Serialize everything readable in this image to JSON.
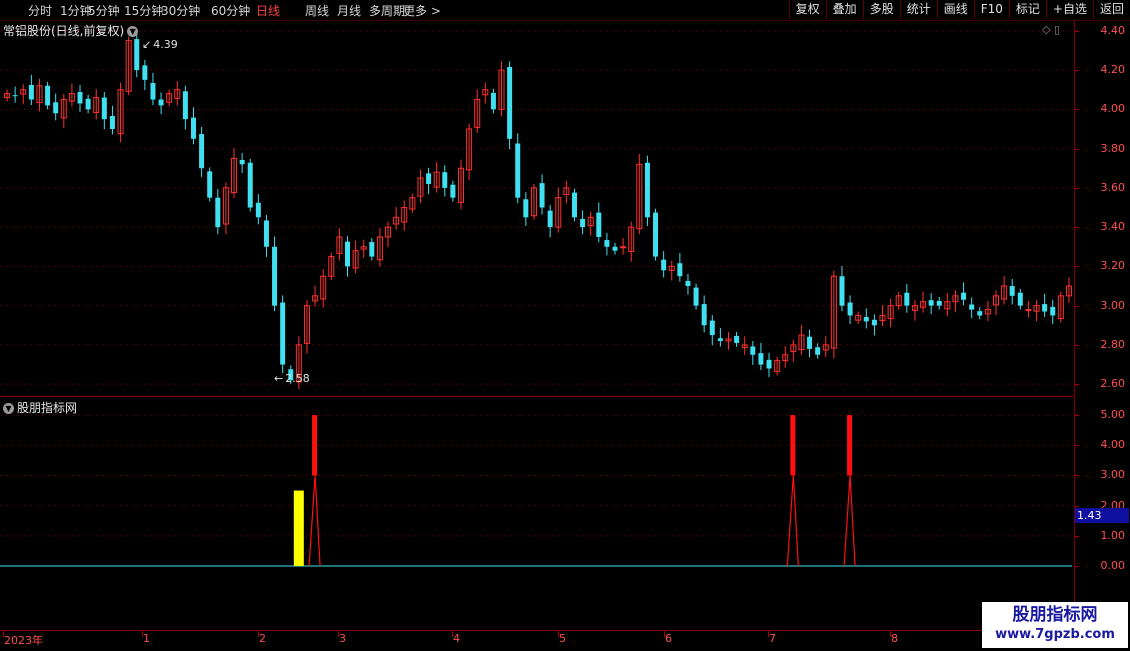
{
  "toolbar": {
    "periods": [
      "分时",
      "1分钟",
      "5分钟",
      "15分钟",
      "30分钟",
      "60分钟",
      "日线",
      "周线",
      "月线",
      "多周期",
      "更多"
    ],
    "active_period": "日线",
    "right_buttons": [
      "复权",
      "叠加",
      "多股",
      "统计",
      "画线",
      "F10",
      "标记",
      "+自选",
      "返回"
    ]
  },
  "main_panel": {
    "title": "常铝股份(日线,前复权)",
    "high_label": "4.39",
    "low_label": "2.58",
    "y_ticks": [
      "4.40",
      "4.20",
      "4.00",
      "3.80",
      "3.60",
      "3.40",
      "3.20",
      "3.00",
      "2.80",
      "2.60"
    ]
  },
  "indicator_panel": {
    "title": "股朋指标网",
    "y_ticks": [
      "5.00",
      "4.00",
      "3.00",
      "2.00",
      "1.00",
      "0.00"
    ],
    "current_value": "1.43"
  },
  "x_axis": {
    "labels": [
      "2023年",
      "1",
      "2",
      "3",
      "4",
      "5",
      "6",
      "7",
      "8"
    ]
  },
  "watermark": {
    "line1": "股朋指标网",
    "line2": "www.7gpzb.com"
  },
  "colors": {
    "up": "#ff3030",
    "down": "#40e0f0",
    "signal_red": "#ff1010",
    "signal_yellow": "#ffff00",
    "zero_line": "#40e0f0"
  },
  "chart_data": {
    "type": "candlestick",
    "title": "常铝股份(日线,前复权)",
    "price_range": [
      2.55,
      4.45
    ],
    "high": 4.39,
    "low": 2.58,
    "close_path": [
      4.08,
      4.07,
      4.1,
      4.05,
      4.12,
      4.02,
      3.98,
      4.05,
      4.08,
      4.03,
      4.0,
      4.06,
      3.95,
      3.9,
      4.1,
      4.35,
      4.2,
      4.15,
      4.05,
      4.02,
      4.08,
      4.1,
      3.95,
      3.85,
      3.7,
      3.55,
      3.4,
      3.6,
      3.75,
      3.72,
      3.5,
      3.45,
      3.3,
      3.0,
      2.7,
      2.62,
      2.8,
      3.0,
      3.05,
      3.15,
      3.25,
      3.35,
      3.2,
      3.28,
      3.3,
      3.25,
      3.35,
      3.4,
      3.45,
      3.5,
      3.55,
      3.65,
      3.62,
      3.68,
      3.6,
      3.55,
      3.7,
      3.9,
      4.05,
      4.1,
      4.0,
      4.2,
      3.85,
      3.55,
      3.45,
      3.6,
      3.5,
      3.4,
      3.55,
      3.6,
      3.45,
      3.4,
      3.45,
      3.35,
      3.3,
      3.28,
      3.3,
      3.4,
      3.72,
      3.45,
      3.25,
      3.18,
      3.2,
      3.15,
      3.1,
      3.0,
      2.9,
      2.85,
      2.82,
      2.83,
      2.81,
      2.8,
      2.75,
      2.7,
      2.68,
      2.72,
      2.75,
      2.8,
      2.85,
      2.78,
      2.75,
      2.8,
      3.15,
      3.0,
      2.95,
      2.95,
      2.92,
      2.9,
      2.95,
      3.0,
      3.05,
      3.0,
      3.0,
      3.02,
      3.0,
      3.0,
      3.02,
      3.05,
      3.03,
      2.98,
      2.95,
      2.98,
      3.05,
      3.1,
      3.05,
      3.0,
      2.98,
      3.0,
      2.97,
      2.95,
      3.05,
      3.1
    ],
    "indicator": {
      "red_signals": [
        {
          "x_index": 38,
          "value": 5.0
        },
        {
          "x_index": 97,
          "value": 5.0
        },
        {
          "x_index": 104,
          "value": 5.0
        }
      ],
      "yellow_bar": {
        "x_index": 36,
        "value": 2.5
      },
      "range": [
        0,
        5.5
      ]
    }
  }
}
